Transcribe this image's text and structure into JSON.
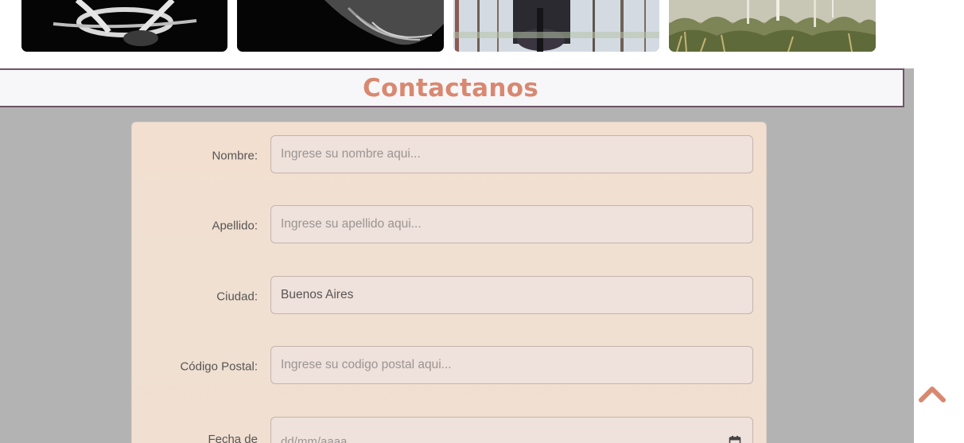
{
  "gallery": {
    "images": [
      {
        "name": "bw-bones-image"
      },
      {
        "name": "bw-fur-image"
      },
      {
        "name": "forest-reflection-image"
      },
      {
        "name": "desert-grass-image"
      }
    ]
  },
  "contact": {
    "title": "Contactanos",
    "fields": {
      "nombre": {
        "label": "Nombre:",
        "placeholder": "Ingrese su nombre aqui..."
      },
      "apellido": {
        "label": "Apellido:",
        "placeholder": "Ingrese su apellido aqui..."
      },
      "ciudad": {
        "label": "Ciudad:",
        "value": "Buenos Aires"
      },
      "codigo_postal": {
        "label": "Código Postal:",
        "placeholder": "Ingrese su codigo postal aqui..."
      },
      "fecha": {
        "label": "Fecha de",
        "placeholder": "dd/mm/aaaa",
        "icon": "calendar-icon"
      }
    }
  },
  "scroll_top": {
    "icon": "chevron-up-icon"
  },
  "colors": {
    "accent": "#d98870",
    "section_bg": "#b4b3b3",
    "card_bg": "#f2dfd0",
    "header_border": "#6d5566"
  }
}
